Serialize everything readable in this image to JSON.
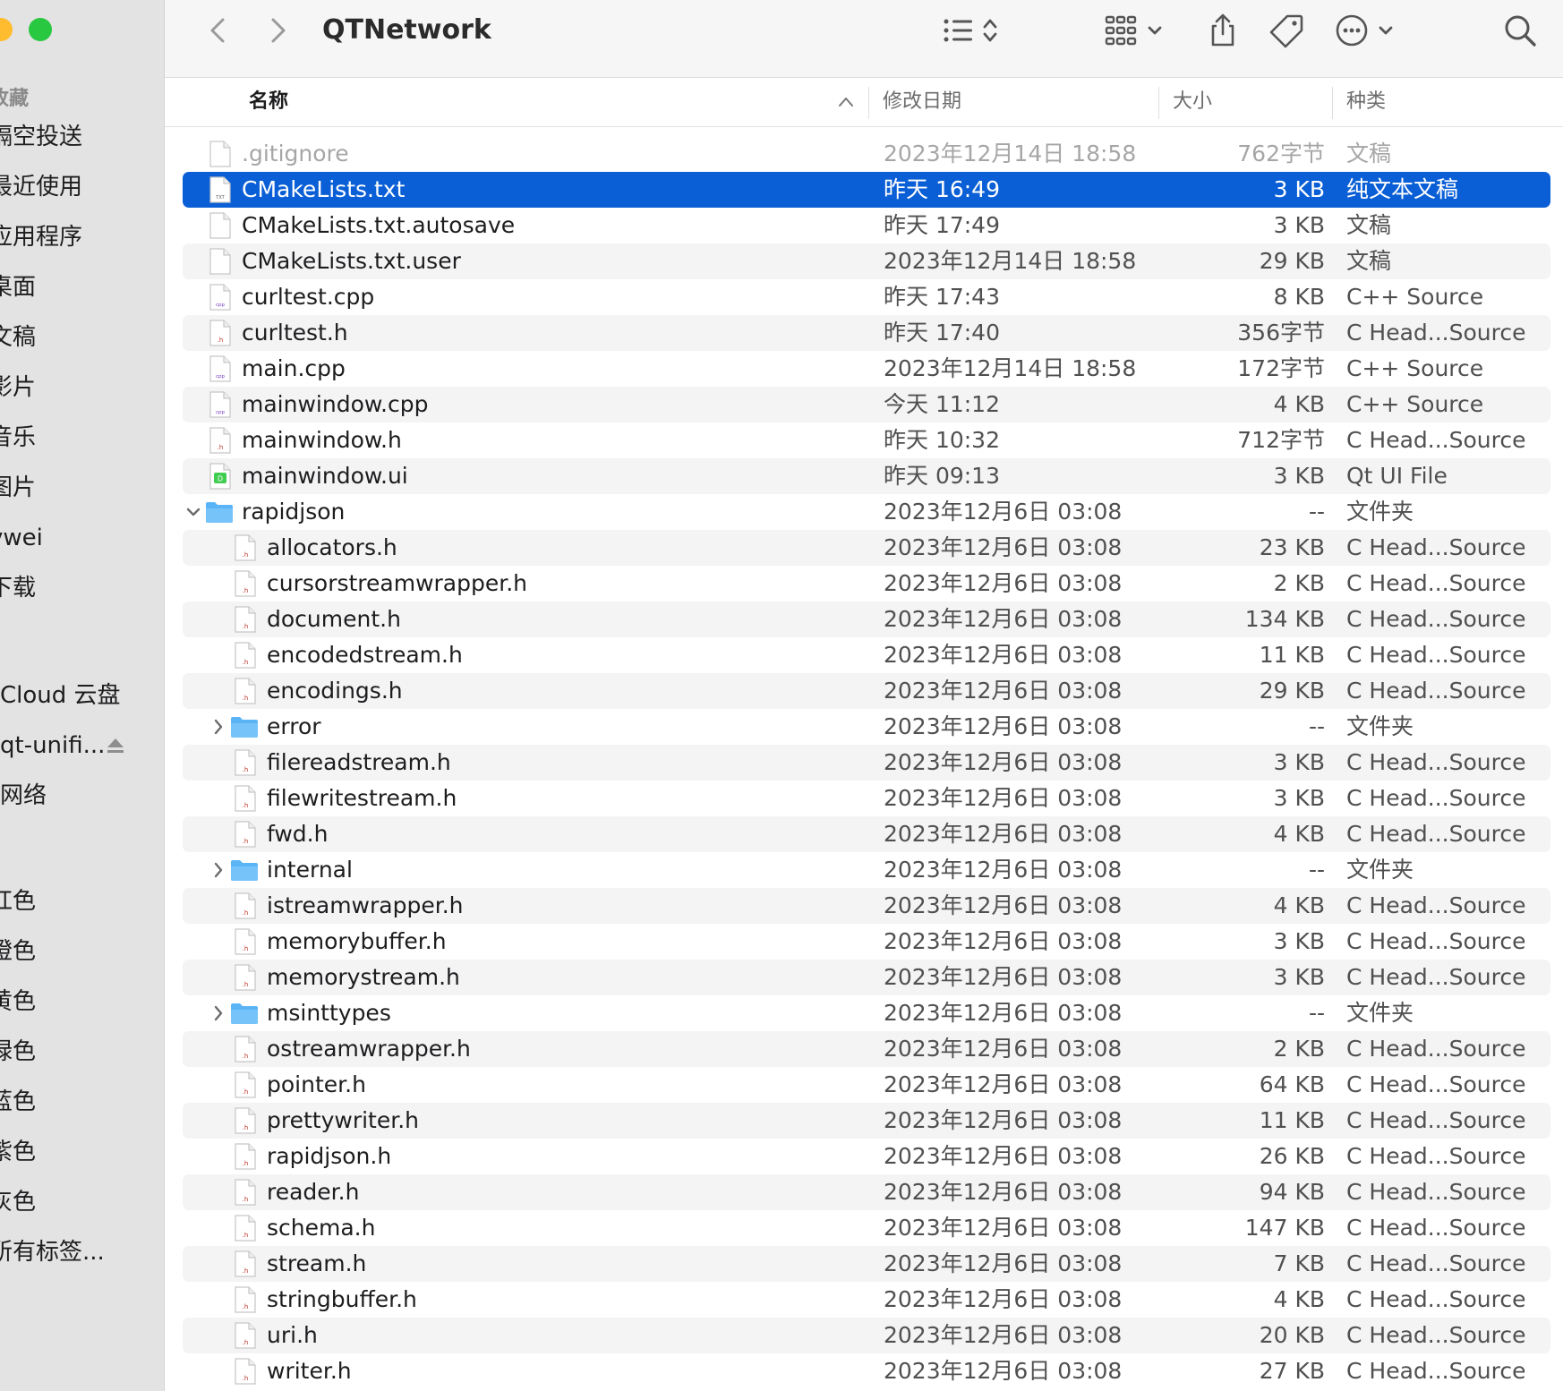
{
  "window": {
    "title": "QTNetwork",
    "colors": {
      "selection": "#0a5fd6",
      "folder": "#5ab4f5",
      "sidebar": "#e4e3e3"
    }
  },
  "sidebar": {
    "favorites_header": "收藏",
    "items": [
      {
        "label": "隔空投送"
      },
      {
        "label": "最近使用"
      },
      {
        "label": "应用程序"
      },
      {
        "label": "桌面"
      },
      {
        "label": "文稿"
      },
      {
        "label": "影片"
      },
      {
        "label": "音乐"
      },
      {
        "label": "图片"
      },
      {
        "label": "vwei"
      },
      {
        "label": "下载"
      }
    ],
    "locations": [
      {
        "label": "Cloud 云盘"
      },
      {
        "label": "qt-unifi..."
      },
      {
        "label": "网络"
      }
    ],
    "tags": [
      {
        "label": "红色"
      },
      {
        "label": "橙色"
      },
      {
        "label": "黄色"
      },
      {
        "label": "绿色"
      },
      {
        "label": "蓝色"
      },
      {
        "label": "紫色"
      },
      {
        "label": "灰色"
      },
      {
        "label": "所有标签..."
      }
    ]
  },
  "toolbar": {
    "icons": [
      "back-icon",
      "forward-icon",
      "list-view-icon",
      "sort-arrows-icon",
      "grid-view-icon",
      "chevron-down-icon",
      "share-icon",
      "tag-icon",
      "more-icon",
      "chevron-down-icon",
      "search-icon"
    ]
  },
  "columns": {
    "name": "名称",
    "date": "修改日期",
    "size": "大小",
    "kind": "种类",
    "sort": "name-ascending"
  },
  "files": [
    {
      "name": ".gitignore",
      "date": "2023年12月14日 18:58",
      "size": "762字节",
      "kind": "文稿",
      "icon": "doc",
      "level": 0,
      "dim": true
    },
    {
      "name": "CMakeLists.txt",
      "date": "昨天 16:49",
      "size": "3 KB",
      "kind": "纯文本文稿",
      "icon": "txt",
      "level": 0,
      "selected": true
    },
    {
      "name": "CMakeLists.txt.autosave",
      "date": "昨天 17:49",
      "size": "3 KB",
      "kind": "文稿",
      "icon": "doc",
      "level": 0
    },
    {
      "name": "CMakeLists.txt.user",
      "date": "2023年12月14日 18:58",
      "size": "29 KB",
      "kind": "文稿",
      "icon": "doc",
      "level": 0
    },
    {
      "name": "curltest.cpp",
      "date": "昨天 17:43",
      "size": "8 KB",
      "kind": "C++ Source",
      "icon": "cpp",
      "level": 0
    },
    {
      "name": "curltest.h",
      "date": "昨天 17:40",
      "size": "356字节",
      "kind": "C Head...Source",
      "icon": "h",
      "level": 0
    },
    {
      "name": "main.cpp",
      "date": "2023年12月14日 18:58",
      "size": "172字节",
      "kind": "C++ Source",
      "icon": "cpp",
      "level": 0
    },
    {
      "name": "mainwindow.cpp",
      "date": "今天 11:12",
      "size": "4 KB",
      "kind": "C++ Source",
      "icon": "cpp",
      "level": 0
    },
    {
      "name": "mainwindow.h",
      "date": "昨天 10:32",
      "size": "712字节",
      "kind": "C Head...Source",
      "icon": "h",
      "level": 0
    },
    {
      "name": "mainwindow.ui",
      "date": "昨天 09:13",
      "size": "3 KB",
      "kind": "Qt UI File",
      "icon": "ui",
      "level": 0
    },
    {
      "name": "rapidjson",
      "date": "2023年12月6日 03:08",
      "size": "--",
      "kind": "文件夹",
      "icon": "folder",
      "level": 0,
      "expanded": true
    },
    {
      "name": "allocators.h",
      "date": "2023年12月6日 03:08",
      "size": "23 KB",
      "kind": "C Head...Source",
      "icon": "h",
      "level": 1
    },
    {
      "name": "cursorstreamwrapper.h",
      "date": "2023年12月6日 03:08",
      "size": "2 KB",
      "kind": "C Head...Source",
      "icon": "h",
      "level": 1
    },
    {
      "name": "document.h",
      "date": "2023年12月6日 03:08",
      "size": "134 KB",
      "kind": "C Head...Source",
      "icon": "h",
      "level": 1
    },
    {
      "name": "encodedstream.h",
      "date": "2023年12月6日 03:08",
      "size": "11 KB",
      "kind": "C Head...Source",
      "icon": "h",
      "level": 1
    },
    {
      "name": "encodings.h",
      "date": "2023年12月6日 03:08",
      "size": "29 KB",
      "kind": "C Head...Source",
      "icon": "h",
      "level": 1
    },
    {
      "name": "error",
      "date": "2023年12月6日 03:08",
      "size": "--",
      "kind": "文件夹",
      "icon": "folder",
      "level": 1,
      "expanded": false
    },
    {
      "name": "filereadstream.h",
      "date": "2023年12月6日 03:08",
      "size": "3 KB",
      "kind": "C Head...Source",
      "icon": "h",
      "level": 1
    },
    {
      "name": "filewritestream.h",
      "date": "2023年12月6日 03:08",
      "size": "3 KB",
      "kind": "C Head...Source",
      "icon": "h",
      "level": 1
    },
    {
      "name": "fwd.h",
      "date": "2023年12月6日 03:08",
      "size": "4 KB",
      "kind": "C Head...Source",
      "icon": "h",
      "level": 1
    },
    {
      "name": "internal",
      "date": "2023年12月6日 03:08",
      "size": "--",
      "kind": "文件夹",
      "icon": "folder",
      "level": 1,
      "expanded": false
    },
    {
      "name": "istreamwrapper.h",
      "date": "2023年12月6日 03:08",
      "size": "4 KB",
      "kind": "C Head...Source",
      "icon": "h",
      "level": 1
    },
    {
      "name": "memorybuffer.h",
      "date": "2023年12月6日 03:08",
      "size": "3 KB",
      "kind": "C Head...Source",
      "icon": "h",
      "level": 1
    },
    {
      "name": "memorystream.h",
      "date": "2023年12月6日 03:08",
      "size": "3 KB",
      "kind": "C Head...Source",
      "icon": "h",
      "level": 1
    },
    {
      "name": "msinttypes",
      "date": "2023年12月6日 03:08",
      "size": "--",
      "kind": "文件夹",
      "icon": "folder",
      "level": 1,
      "expanded": false
    },
    {
      "name": "ostreamwrapper.h",
      "date": "2023年12月6日 03:08",
      "size": "2 KB",
      "kind": "C Head...Source",
      "icon": "h",
      "level": 1
    },
    {
      "name": "pointer.h",
      "date": "2023年12月6日 03:08",
      "size": "64 KB",
      "kind": "C Head...Source",
      "icon": "h",
      "level": 1
    },
    {
      "name": "prettywriter.h",
      "date": "2023年12月6日 03:08",
      "size": "11 KB",
      "kind": "C Head...Source",
      "icon": "h",
      "level": 1
    },
    {
      "name": "rapidjson.h",
      "date": "2023年12月6日 03:08",
      "size": "26 KB",
      "kind": "C Head...Source",
      "icon": "h",
      "level": 1
    },
    {
      "name": "reader.h",
      "date": "2023年12月6日 03:08",
      "size": "94 KB",
      "kind": "C Head...Source",
      "icon": "h",
      "level": 1
    },
    {
      "name": "schema.h",
      "date": "2023年12月6日 03:08",
      "size": "147 KB",
      "kind": "C Head...Source",
      "icon": "h",
      "level": 1
    },
    {
      "name": "stream.h",
      "date": "2023年12月6日 03:08",
      "size": "7 KB",
      "kind": "C Head...Source",
      "icon": "h",
      "level": 1
    },
    {
      "name": "stringbuffer.h",
      "date": "2023年12月6日 03:08",
      "size": "4 KB",
      "kind": "C Head...Source",
      "icon": "h",
      "level": 1
    },
    {
      "name": "uri.h",
      "date": "2023年12月6日 03:08",
      "size": "20 KB",
      "kind": "C Head...Source",
      "icon": "h",
      "level": 1
    },
    {
      "name": "writer.h",
      "date": "2023年12月6日 03:08",
      "size": "27 KB",
      "kind": "C Head...Source",
      "icon": "h",
      "level": 1
    }
  ]
}
